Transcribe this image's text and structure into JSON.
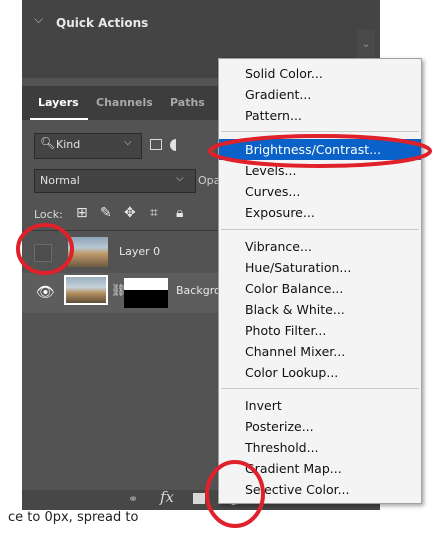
{
  "quick_actions": {
    "title": "Quick Actions"
  },
  "tabs": [
    "Layers",
    "Channels",
    "Paths"
  ],
  "filter": {
    "kind_label": "Kind"
  },
  "blend": {
    "mode": "Normal",
    "opacity_label": "Opa"
  },
  "lock": {
    "label": "Lock:"
  },
  "layers": [
    {
      "name": "Layer 0",
      "visible": false
    },
    {
      "name": "Backgro",
      "visible": true
    }
  ],
  "bottom_bar": {
    "fx": "fx"
  },
  "adjustment_menu": {
    "group1": [
      "Solid Color...",
      "Gradient...",
      "Pattern..."
    ],
    "group2": [
      "Brightness/Contrast...",
      "Levels...",
      "Curves...",
      "Exposure..."
    ],
    "group3": [
      "Vibrance...",
      "Hue/Saturation...",
      "Color Balance...",
      "Black & White...",
      "Photo Filter...",
      "Channel Mixer...",
      "Color Lookup..."
    ],
    "group4": [
      "Invert",
      "Posterize...",
      "Threshold...",
      "Gradient Map...",
      "Selective Color..."
    ],
    "highlighted": "Brightness/Contrast..."
  },
  "caption": "ce to 0px, spread to",
  "colors": {
    "highlight": "#0a62c8",
    "annotation": "#e0202a",
    "panel": "#535353"
  },
  "icons": [
    "chevron-down-icon",
    "search-icon",
    "image-filter-icon",
    "adjustment-filter-icon",
    "lock-pixels-icon",
    "brush-icon",
    "move-icon",
    "artboard-icon",
    "lock-icon",
    "eye-icon",
    "chain-link-icon",
    "link-icon",
    "fx-icon",
    "add-mask-icon",
    "new-adjustment-layer-icon",
    "group-icon",
    "new-layer-icon",
    "trash-icon"
  ]
}
